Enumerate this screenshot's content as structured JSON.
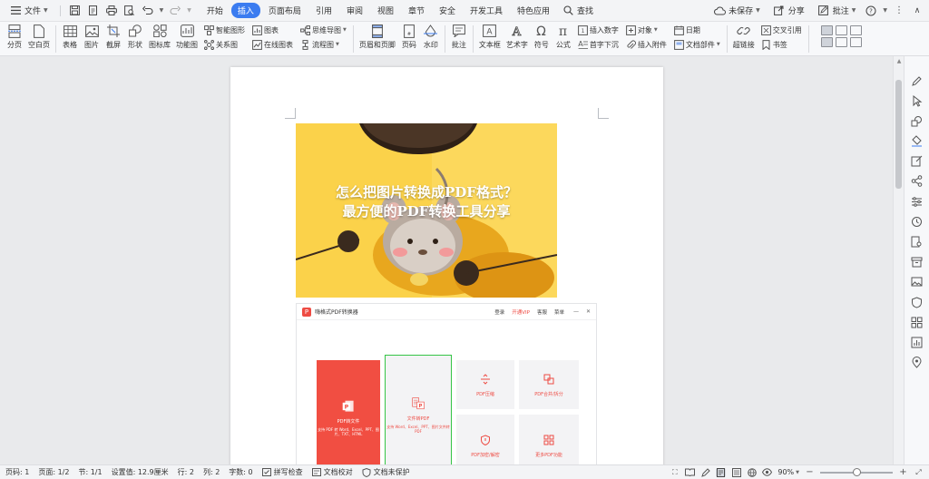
{
  "menubar": {
    "file_label": "文件",
    "tabs": [
      {
        "label": "开始",
        "active": false
      },
      {
        "label": "插入",
        "active": true
      },
      {
        "label": "页面布局",
        "active": false
      },
      {
        "label": "引用",
        "active": false
      },
      {
        "label": "审阅",
        "active": false
      },
      {
        "label": "视图",
        "active": false
      },
      {
        "label": "章节",
        "active": false
      },
      {
        "label": "安全",
        "active": false
      },
      {
        "label": "开发工具",
        "active": false
      },
      {
        "label": "特色应用",
        "active": false
      }
    ],
    "search_label": "查找",
    "unsaved_label": "未保存",
    "share_label": "分享",
    "comment_label": "批注"
  },
  "ribbon": {
    "page_break": "分页",
    "blank_page": "空白页",
    "table": "表格",
    "picture": "图片",
    "screenshot": "截屏",
    "shapes": "形状",
    "icon_library": "图标库",
    "function_chart": "功能图",
    "smart_art": "智能图形",
    "chart": "图表",
    "mind_map": "思维导图",
    "relation_chart": "关系图",
    "online_chart": "在线图表",
    "flow_chart": "流程图",
    "header_footer": "页眉和页脚",
    "page_number": "页码",
    "watermark": "水印",
    "comment": "批注",
    "text_box": "文本框",
    "word_art": "艺术字",
    "symbol": "符号",
    "formula": "公式",
    "insert_number": "插入数字",
    "drop_cap": "首字下沉",
    "object": "对象",
    "insert_attachment": "插入附件",
    "date": "日期",
    "doc_parts": "文档部件",
    "hyperlink": "超链接",
    "cross_ref": "交叉引用",
    "bookmark": "书签"
  },
  "document": {
    "hero_line1": "怎么把图片转换成PDF格式？",
    "hero_line2": "最方便的PDF转换工具分享",
    "app": {
      "title": "嗨格式PDF转换器",
      "links": [
        "登录",
        "开通VIP",
        "客服",
        "菜单"
      ],
      "vip_link": "开通VIP",
      "cards": {
        "pdf_to_file": "PDF转文件",
        "pdf_to_file_desc": "支持 PDF 转 Word、Excel、PPT、图片、TXT、HTML",
        "file_to_pdf": "文件转PDF",
        "file_to_pdf_desc": "支持 Word、Excel、PPT、图片文件转 PDF",
        "pdf_compress": "PDF压缩",
        "pdf_merge_split": "PDF合并/拆分",
        "pdf_encrypt": "PDF加密/解密",
        "more": "更多PDF功能"
      }
    }
  },
  "statusbar": {
    "page_code": "页码: 1",
    "pages": "页面: 1/2",
    "section": "节: 1/1",
    "setting": "设置值: 12.9厘米",
    "row": "行: 2",
    "col": "列: 2",
    "word_count": "字数: 0",
    "spell_check": "拼写检查",
    "doc_proof": "文档校对",
    "doc_protect": "文档未保护",
    "zoom": "90%",
    "zoom_fraction": 0.5
  },
  "colors": {
    "accent": "#3b7cf0",
    "app_red": "#f14e42",
    "hero_yellow": "#fbd24a",
    "selection_green": "#35c446"
  }
}
